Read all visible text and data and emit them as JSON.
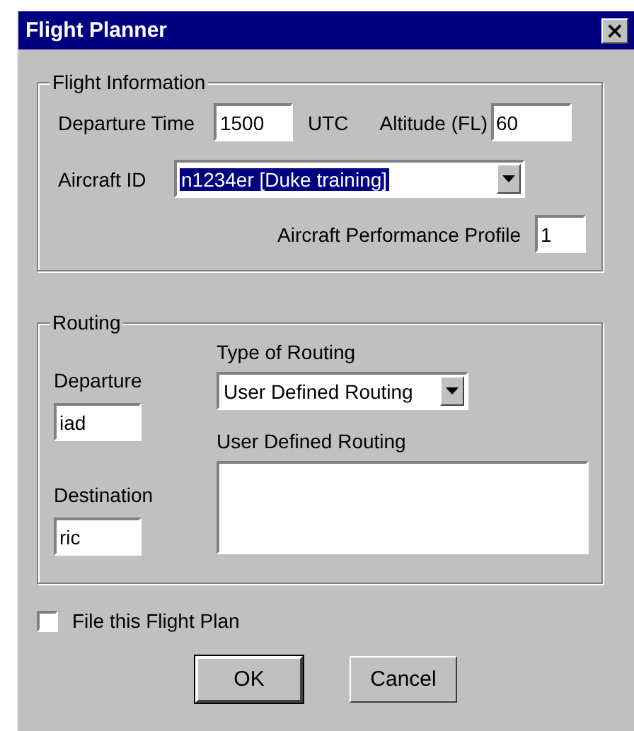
{
  "window": {
    "title": "Flight Planner",
    "close": "×"
  },
  "flight_information": {
    "legend": "Flight Information",
    "departure_time": {
      "label": "Departure Time",
      "value": "1500",
      "unit": "UTC"
    },
    "altitude": {
      "label": "Altitude (FL)",
      "value": "60"
    },
    "aircraft_id": {
      "label": "Aircraft ID",
      "value": "n1234er [Duke training]",
      "text_selected": true
    },
    "performance_profile": {
      "label": "Aircraft Performance Profile",
      "value": "1"
    }
  },
  "routing": {
    "legend": "Routing",
    "departure": {
      "label": "Departure",
      "value": "iad"
    },
    "destination": {
      "label": "Destination",
      "value": "ric"
    },
    "type_of_routing": {
      "label": "Type of Routing",
      "value": "User Defined Routing"
    },
    "user_defined_routing": {
      "label": "User Defined Routing"
    }
  },
  "file_flight_plan": {
    "label": "File this Flight Plan",
    "checked": false
  },
  "buttons": [
    {
      "label": "OK",
      "default": true
    },
    {
      "label": "Cancel",
      "default": false
    }
  ]
}
